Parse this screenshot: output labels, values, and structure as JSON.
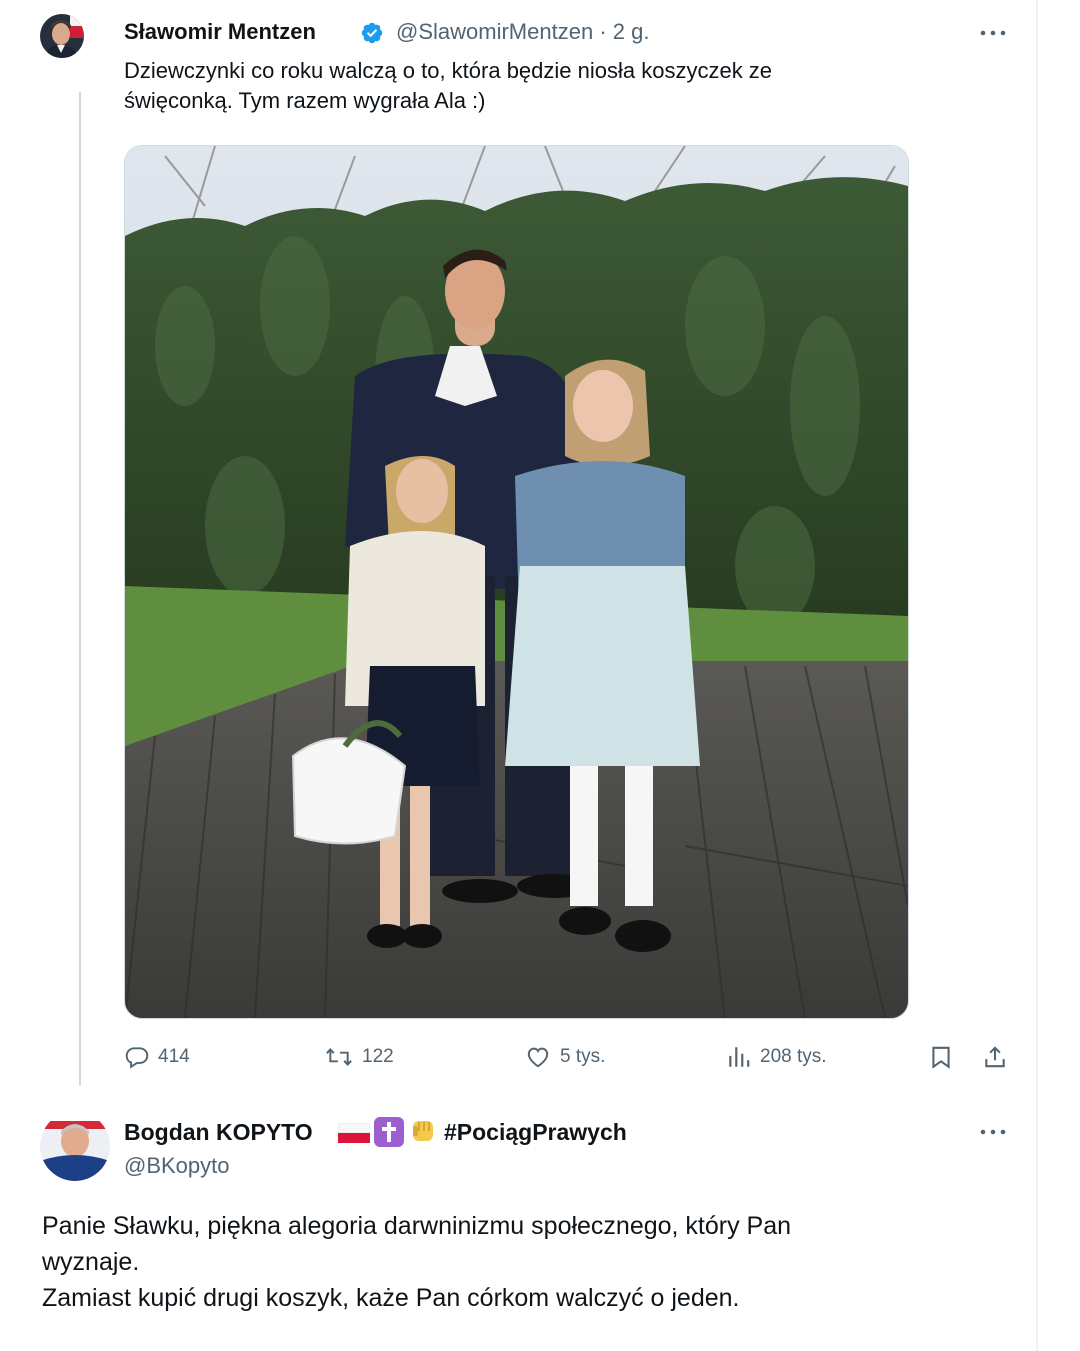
{
  "tweet": {
    "author_name": "Sławomir Mentzen",
    "handle": "@SlawomirMentzen",
    "separator": "·",
    "time": "2 g.",
    "text_line1": "Dziewczynki co roku walczą o to, która będzie niosła koszyczek ze",
    "text_line2": "święconką. Tym razem wygrała Ala :)",
    "stats": {
      "replies": "414",
      "retweets": "122",
      "likes": "5 tys.",
      "views": "208 tys."
    }
  },
  "reply": {
    "author_name": "Bogdan KOPYTO",
    "hashtag": "#PociągPrawych",
    "handle": "@BKopyto",
    "text_line1": "Panie Sławku, piękna alegoria darwninizmu społecznego, który Pan",
    "text_line2": "wyznaje.",
    "text_line3": "Zamiast kupić drugi koszyk, każe Pan córkom walczyć o jeden."
  },
  "colors": {
    "text": "#0f1419",
    "muted": "#536471",
    "verified": "#1d9bf0",
    "thread_line": "#cfd9de"
  },
  "icons": [
    "verified-badge-icon",
    "more-icon",
    "reply-icon",
    "retweet-icon",
    "like-icon",
    "views-icon",
    "bookmark-icon",
    "share-icon",
    "poland-flag-icon",
    "cross-icon",
    "fist-icon"
  ]
}
